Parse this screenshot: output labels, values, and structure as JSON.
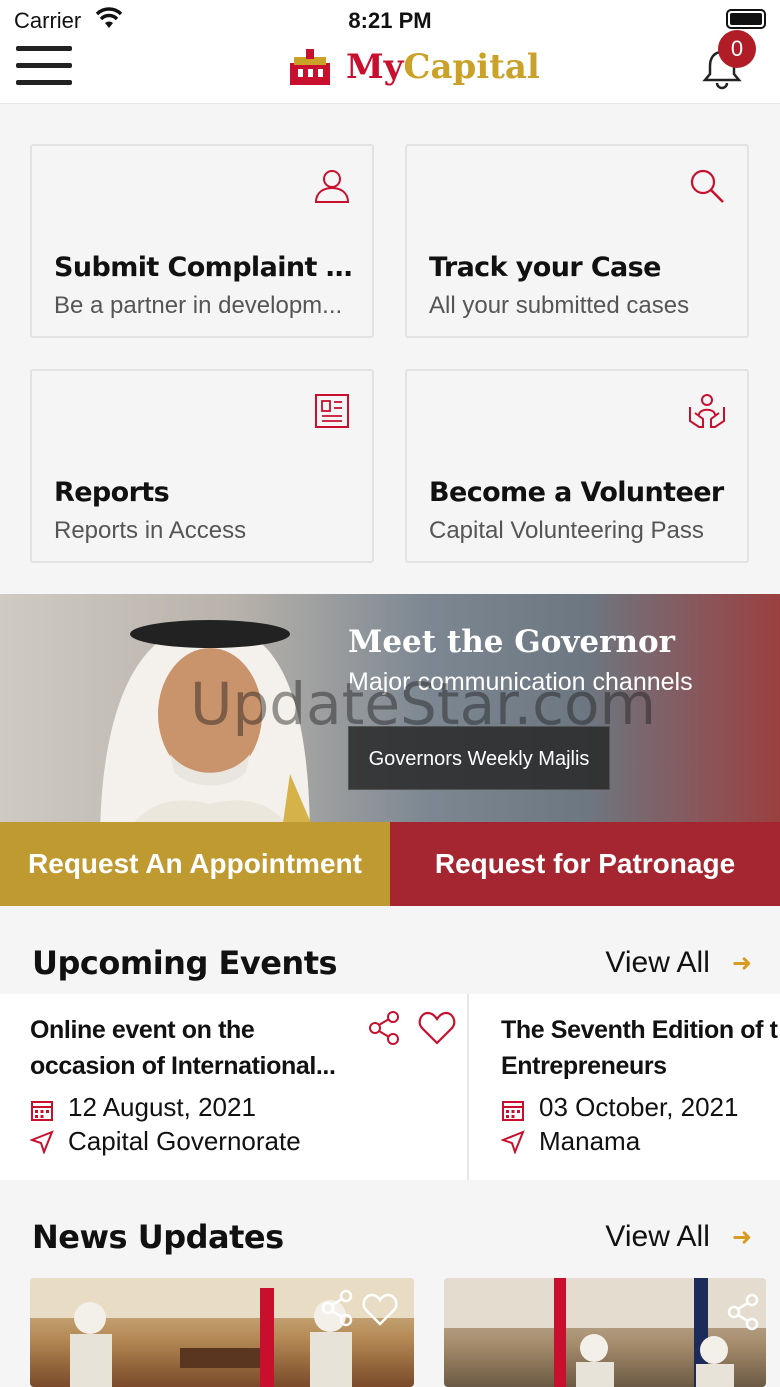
{
  "status": {
    "carrier": "Carrier",
    "time": "8:21 PM"
  },
  "nav": {
    "logo_my": "My",
    "logo_capital": "Capital",
    "notification_count": "0"
  },
  "cards": [
    {
      "title": "Submit Complaint / Su...",
      "subtitle": "Be a partner in developm...",
      "icon": "user-icon"
    },
    {
      "title": "Track your Case",
      "subtitle": "All your submitted cases",
      "icon": "search-icon"
    },
    {
      "title": "Reports",
      "subtitle": "Reports in Access",
      "icon": "report-icon"
    },
    {
      "title": "Become a Volunteer",
      "subtitle": "Capital Volunteering Pass",
      "icon": "volunteer-icon"
    }
  ],
  "hero": {
    "title": "Meet the Governor",
    "subtitle": "Major communication channels",
    "button": "Governors Weekly Majlis",
    "watermark": "UpdateStar.com"
  },
  "actions": {
    "appointment": "Request An Appointment",
    "patronage": "Request for Patronage"
  },
  "events_section": {
    "title": "Upcoming Events",
    "view_all": "View All"
  },
  "events": [
    {
      "title": "Online event on the occasion of International...",
      "date": "12 August, 2021",
      "location": "Capital Governorate"
    },
    {
      "title": "The Seventh Edition of t Manama Entrepreneurs",
      "date": "03 October, 2021",
      "location": "Manama"
    }
  ],
  "news_section": {
    "title": "News Updates",
    "view_all": "View All"
  },
  "colors": {
    "brand_red": "#c8102e",
    "brand_gold": "#c9a227",
    "appointment_bg": "#bf9a31",
    "patronage_bg": "#a52630"
  }
}
